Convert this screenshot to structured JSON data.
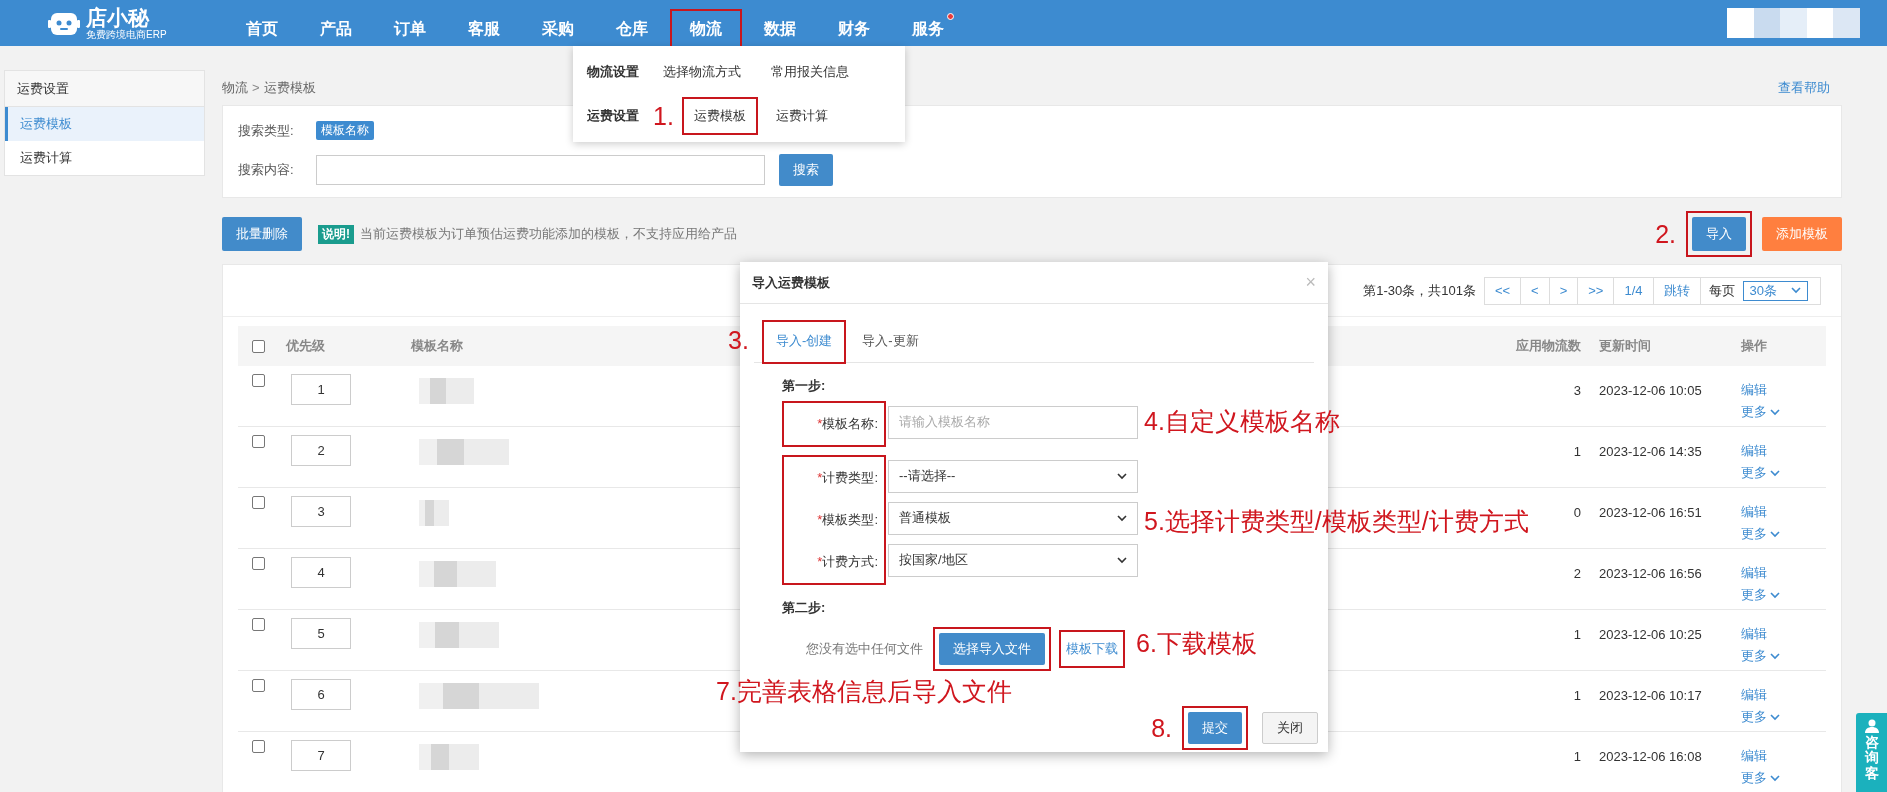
{
  "header": {
    "logo": {
      "title": "店小秘",
      "subtitle": "免费跨境电商ERP"
    },
    "nav": [
      {
        "label": "首页",
        "highlighted": false,
        "dot": false
      },
      {
        "label": "产品",
        "highlighted": false,
        "dot": false
      },
      {
        "label": "订单",
        "highlighted": false,
        "dot": false
      },
      {
        "label": "客服",
        "highlighted": false,
        "dot": false
      },
      {
        "label": "采购",
        "highlighted": false,
        "dot": false
      },
      {
        "label": "仓库",
        "highlighted": false,
        "dot": false
      },
      {
        "label": "物流",
        "highlighted": true,
        "dot": false
      },
      {
        "label": "数据",
        "highlighted": false,
        "dot": false
      },
      {
        "label": "财务",
        "highlighted": false,
        "dot": false
      },
      {
        "label": "服务",
        "highlighted": false,
        "dot": true
      }
    ]
  },
  "nav_menu": {
    "rows": [
      {
        "title": "物流设置",
        "items": [
          {
            "label": "选择物流方式",
            "highlighted": false
          },
          {
            "label": "常用报关信息",
            "highlighted": false
          }
        ]
      },
      {
        "title": "运费设置",
        "items": [
          {
            "label": "运费模板",
            "highlighted": true,
            "annotation": "1."
          },
          {
            "label": "运费计算",
            "highlighted": false
          }
        ]
      }
    ]
  },
  "sidebar": {
    "title": "运费设置",
    "items": [
      {
        "label": "运费模板",
        "selected": true
      },
      {
        "label": "运费计算",
        "selected": false
      }
    ]
  },
  "breadcrumb": {
    "items": [
      "物流",
      "运费模板"
    ],
    "separator": ">"
  },
  "help_link": "查看帮助",
  "search": {
    "type_label": "搜索类型:",
    "type_tag": "模板名称",
    "content_label": "搜索内容:",
    "button": "搜索"
  },
  "toolbar": {
    "delete_button": "批量删除",
    "note_tag": "说明!",
    "note": "当前运费模板为订单预估运费功能添加的模板，不支持应用给产品",
    "buttons": [
      {
        "label": "导入",
        "kind": "primary",
        "highlighted": true,
        "annotation": "2."
      },
      {
        "label": "添加模板",
        "kind": "warning",
        "highlighted": false
      }
    ]
  },
  "pagination": {
    "summary": "第1-30条，共101条",
    "controls": [
      "<<",
      "<",
      ">",
      ">>"
    ],
    "page": "1/4",
    "jump": "跳转",
    "per_page_label": "每页",
    "per_page": "30条"
  },
  "table": {
    "select_all_checked": false,
    "columns": [
      "优先级",
      "模板名称",
      "应用物流数",
      "更新时间",
      "操作"
    ],
    "rows": [
      {
        "checked": false,
        "priority": "1",
        "count": "3",
        "updated": "2023-12-06 10:05",
        "actions": [
          "编辑",
          "更多"
        ]
      },
      {
        "checked": false,
        "priority": "2",
        "count": "1",
        "updated": "2023-12-06 14:35",
        "actions": [
          "编辑",
          "更多"
        ]
      },
      {
        "checked": false,
        "priority": "3",
        "count": "0",
        "updated": "2023-12-06 16:51",
        "actions": [
          "编辑",
          "更多"
        ]
      },
      {
        "checked": false,
        "priority": "4",
        "count": "2",
        "updated": "2023-12-06 16:56",
        "actions": [
          "编辑",
          "更多"
        ]
      },
      {
        "checked": false,
        "priority": "5",
        "count": "1",
        "updated": "2023-12-06 10:25",
        "actions": [
          "编辑",
          "更多"
        ]
      },
      {
        "checked": false,
        "priority": "6",
        "count": "1",
        "updated": "2023-12-06 10:17",
        "actions": [
          "编辑",
          "更多"
        ]
      },
      {
        "checked": false,
        "priority": "7",
        "count": "1",
        "updated": "2023-12-06 16:08",
        "actions": [
          "编辑",
          "更多"
        ]
      }
    ]
  },
  "dialog": {
    "title": "导入运费模板",
    "close": "×",
    "tabs": [
      {
        "label": "导入-创建",
        "selected": true,
        "highlighted": true,
        "annotation": "3."
      },
      {
        "label": "导入-更新",
        "selected": false,
        "highlighted": false
      }
    ],
    "step1": {
      "title": "第一步:",
      "groups": [
        {
          "highlighted": true,
          "annotation": "4.自定义模板名称",
          "fields": [
            {
              "kind": "text",
              "mark": "*",
              "label": "模板名称:",
              "placeholder": "请输入模板名称"
            }
          ]
        },
        {
          "highlighted": true,
          "annotation": "5.选择计费类型/模板类型/计费方式",
          "fields": [
            {
              "kind": "select",
              "mark": "*",
              "label": "计费类型:",
              "value": "--请选择--"
            },
            {
              "kind": "select",
              "mark": "*",
              "label": "模板类型:",
              "value": "普通模板"
            },
            {
              "kind": "select",
              "mark": "*",
              "label": "计费方式:",
              "value": "按国家/地区"
            }
          ]
        }
      ]
    },
    "step2": {
      "title": "第二步:",
      "file_status": "您没有选中任何文件",
      "file_button": {
        "label": "选择导入文件",
        "highlighted": true,
        "annotation": "7.完善表格信息后导入文件"
      },
      "download_link": {
        "label": "模板下载",
        "highlighted": true,
        "annotation": "6.下载模板"
      }
    },
    "footer": [
      {
        "label": "提交",
        "kind": "primary",
        "highlighted": true,
        "annotation": "8."
      },
      {
        "label": "关闭",
        "kind": "default",
        "highlighted": false
      }
    ]
  },
  "chat_tab": {
    "label": "咨询客"
  }
}
